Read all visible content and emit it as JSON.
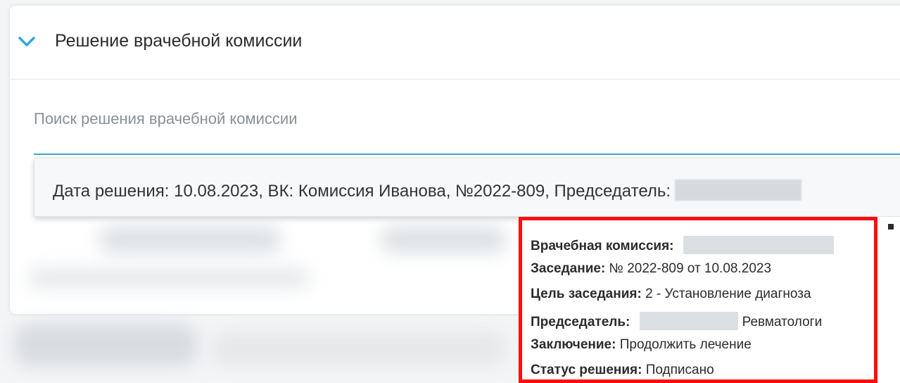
{
  "section": {
    "title": "Решение врачебной комиссии",
    "icon": "chevron-down-icon"
  },
  "search": {
    "label": "Поиск решения врачебной комиссии"
  },
  "dropdown": {
    "item_text": "Дата решения: 10.08.2023, ВК: Комиссия Иванова, №2022-809, Председатель:"
  },
  "tooltip": {
    "commission_label": "Врачебная комиссия:",
    "meeting_label": "Заседание:",
    "meeting_value": " № 2022-809 от 10.08.2023",
    "purpose_label": "Цель заседания:",
    "purpose_value": " 2 - Установление диагноза",
    "chairman_label": "Председатель:",
    "chairman_value": "Ревматологи",
    "conclusion_label": "Заключение:",
    "conclusion_value": " Продолжить лечение",
    "status_label": "Статус решения:",
    "status_value": " Подписано"
  },
  "colors": {
    "accent": "#35a7d8",
    "highlight_border": "#ff0d0d"
  }
}
